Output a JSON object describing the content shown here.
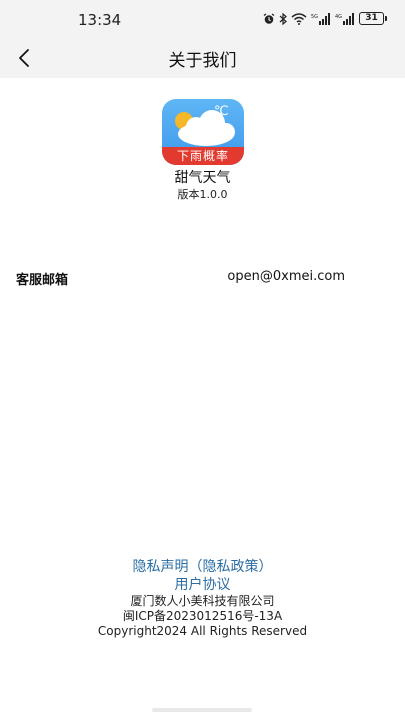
{
  "status_bar": {
    "time": "13:34",
    "battery": "31",
    "signal_label_1": "5G",
    "signal_label_2": "4G"
  },
  "nav": {
    "title": "关于我们",
    "back_icon": "chevron-left-icon"
  },
  "app": {
    "icon_banner": "下雨概率",
    "name": "甜气天气",
    "version": "版本1.0.0",
    "icon_colors": {
      "sky": "#4aa6ef",
      "banner": "#e23a2e",
      "sun": "#f5b82a",
      "cloud": "#ffffff"
    }
  },
  "contact": {
    "email_label": "客服邮箱",
    "email_value": "open@0xmei.com"
  },
  "footer": {
    "privacy_link": "隐私声明（隐私政策）",
    "user_agreement_link": "用户协议",
    "company": "厦门数人小美科技有限公司",
    "icp": "闽ICP备2023012516号-13A",
    "copyright": "Copyright2024 All Rights Reserved",
    "link_color": "#2b6ea3"
  }
}
